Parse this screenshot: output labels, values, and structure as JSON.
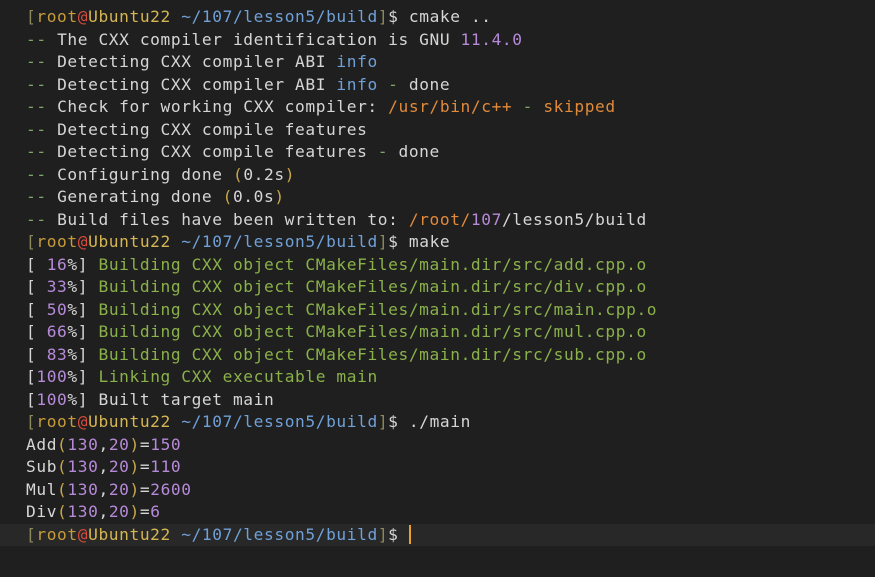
{
  "prompt": {
    "user": "root",
    "at": "@",
    "host": "Ubuntu22",
    "path": "~/107/lesson5/build",
    "symbol": "$"
  },
  "lines": {
    "cmd_cmake": "cmake ..",
    "cmake1_a": "The CXX compiler identification is GNU ",
    "cmake1_b": "11.4.0",
    "cmake2_a": "Detecting CXX compiler ABI ",
    "cmake2_b": "info",
    "cmake3_a": "Detecting CXX compiler ABI ",
    "cmake3_b": "info",
    "cmake3_c": " - ",
    "cmake3_d": "done",
    "cmake4_a": "Check for working CXX compiler: ",
    "cmake4_b": "/usr/bin/c++",
    "cmake4_c": " - ",
    "cmake4_d": "skipped",
    "cmake5_a": "Detecting CXX compile features",
    "cmake6_a": "Detecting CXX compile features",
    "cmake6_b": " - ",
    "cmake6_c": "done",
    "cmake7_a": "Configuring done ",
    "cmake7_b": "(",
    "cmake7_c": "0.2s",
    "cmake7_d": ")",
    "cmake8_a": "Generating done ",
    "cmake8_b": "(",
    "cmake8_c": "0.0s",
    "cmake8_d": ")",
    "cmake9_a": "Build files have been written to: ",
    "cmake9_b": "/root/",
    "cmake9_c": "107",
    "cmake9_d": "/lesson5/build",
    "cmd_make": "make",
    "build1_pct": " 16",
    "build1_text": "Building CXX object CMakeFiles/main.dir/src/add.cpp.o",
    "build2_pct": " 33",
    "build2_text": "Building CXX object CMakeFiles/main.dir/src/div.cpp.o",
    "build3_pct": " 50",
    "build3_text": "Building CXX object CMakeFiles/main.dir/src/main.cpp.o",
    "build4_pct": " 66",
    "build4_text": "Building CXX object CMakeFiles/main.dir/src/mul.cpp.o",
    "build5_pct": " 83",
    "build5_text": "Building CXX object CMakeFiles/main.dir/src/sub.cpp.o",
    "link_pct": "100",
    "link_text": "Linking CXX executable main",
    "built_pct": "100",
    "built_text": "Built target main",
    "cmd_run": "./main",
    "out1_name": "Add",
    "out1_args": "130",
    "out1_args2": "20",
    "out1_res": "150",
    "out2_name": "Sub",
    "out2_args": "130",
    "out2_args2": "20",
    "out2_res": "110",
    "out3_name": "Mul",
    "out3_args": "130",
    "out3_args2": "20",
    "out3_res": "2600",
    "out4_name": "Div",
    "out4_args": "130",
    "out4_args2": "20",
    "out4_res": "6"
  },
  "dash": "--",
  "colors": {
    "background": "#1f1f1f",
    "current_line": "#282828",
    "cursor": "#e8a030",
    "text": "#d6d6d6",
    "green": "#8ab14a",
    "purple": "#b68ad8",
    "blue": "#6fa0d8",
    "orange": "#e08a3a"
  }
}
